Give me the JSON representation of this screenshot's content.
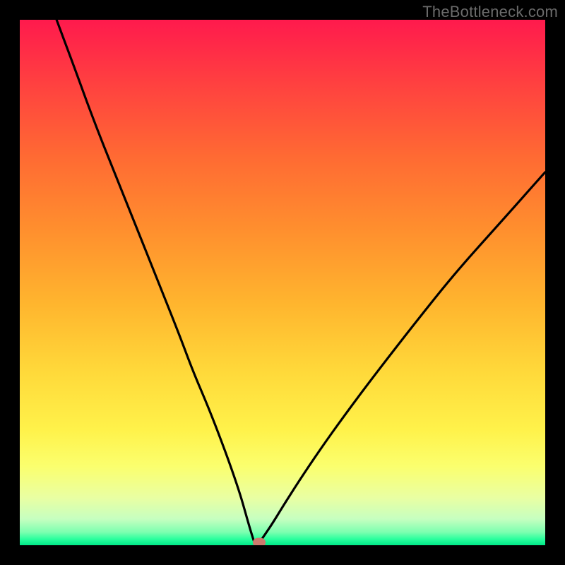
{
  "watermark": {
    "text": "TheBottleneck.com"
  },
  "chart_data": {
    "type": "line",
    "title": "",
    "xlabel": "",
    "ylabel": "",
    "xlim": [
      0,
      100
    ],
    "ylim": [
      0,
      100
    ],
    "grid": false,
    "series": [
      {
        "name": "bottleneck-curve",
        "x": [
          7,
          10,
          14,
          18,
          22,
          26,
          30,
          33,
          36,
          38.5,
          40.5,
          42,
          43,
          43.8,
          44.3,
          44.6,
          45,
          45.6,
          46.5,
          48,
          50,
          53,
          57,
          62,
          68,
          75,
          83,
          92,
          100
        ],
        "y": [
          100,
          92,
          81,
          71,
          61,
          51,
          41,
          33,
          26,
          19.5,
          14,
          9.5,
          6,
          3.2,
          1.6,
          0.6,
          0,
          0.5,
          1.8,
          4,
          7.3,
          12,
          18,
          25,
          33,
          42,
          52,
          62,
          71
        ]
      }
    ],
    "annotations": [
      {
        "name": "min-marker",
        "x": 45.5,
        "y": 0.6
      }
    ],
    "background_gradient": {
      "direction": "vertical",
      "stops": [
        {
          "pos": 0.0,
          "color": "#ff1a4d"
        },
        {
          "pos": 0.4,
          "color": "#ff8f2e"
        },
        {
          "pos": 0.78,
          "color": "#fff24a"
        },
        {
          "pos": 0.95,
          "color": "#c6ffc0"
        },
        {
          "pos": 1.0,
          "color": "#00e887"
        }
      ]
    }
  }
}
